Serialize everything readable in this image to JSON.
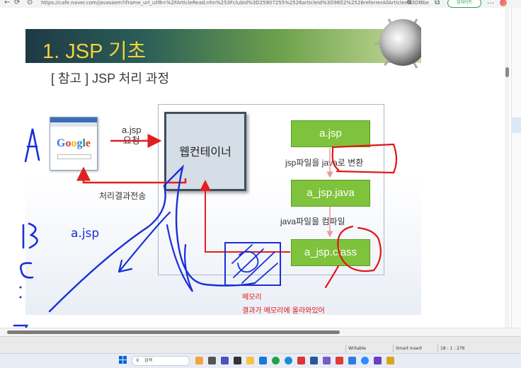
{
  "browser": {
    "url": "https://cafe.naver.com/javassem?iframe_url_utf8=%2FArticleRead.nhn%253Fclubid%3D25907255%2526articleid%3D9652%2526referrerAllArticles%3Dtrue",
    "update_label": "업데이트"
  },
  "slide": {
    "title": "1. JSP 기초",
    "subtitle": "[ 참고 ] JSP 처리 과정",
    "browser_logo": "Google",
    "request_label": "a.jsp\n요청",
    "response_label": "처리결과전송",
    "web_container_label": "웹컨테이너",
    "boxes": [
      "a.jsp",
      "a_jsp.java",
      "a_jsp.class"
    ],
    "step1_label": "jsp파일을 java로 변환",
    "step2_label": "java파일을 컴파일"
  },
  "annotations": {
    "letters": [
      "A",
      "B",
      "C",
      ":",
      "Z"
    ],
    "blue_label": "a.jsp",
    "memory_label": "메모리",
    "memory_note": "결과가 메모리에 올라와있어"
  },
  "statusbar": {
    "mode": "Writable",
    "insert": "Smart Insert",
    "position": "18 : 1 : 276"
  },
  "taskbar": {
    "search": "검색"
  },
  "colors": {
    "title_text": "#f4d13a",
    "green_box": "#7fc23b",
    "red_arrow": "#e02020",
    "blue_ink": "#1a2ed8",
    "red_ink": "#e01414"
  }
}
